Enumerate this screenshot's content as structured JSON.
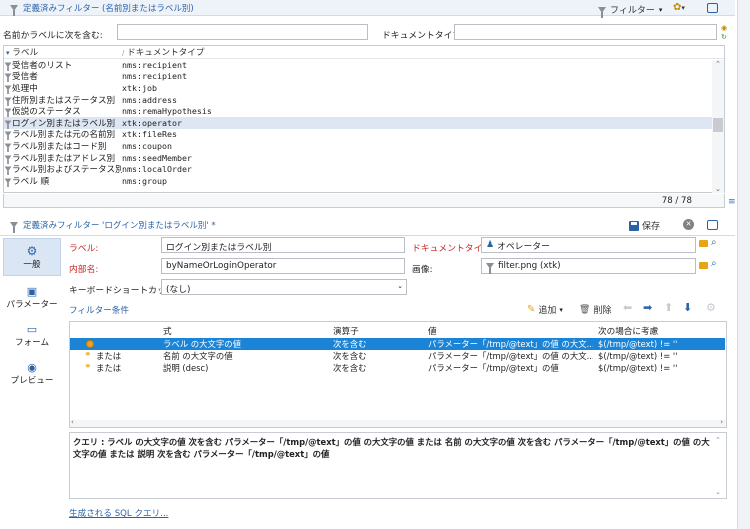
{
  "top": {
    "title": "定義済みフィルター (名前別またはラベル別)",
    "filter_btn": "フィルター",
    "name_label_contains": "名前かラベルに次を含む:",
    "name_value": "",
    "doc_type_label": "ドキュメントタイプ:",
    "doc_type_value": "",
    "col_label": "ラベル",
    "col_doctype": "ドキュメントタイプ",
    "rows": [
      {
        "label": "受信者のリスト",
        "type": "nms:recipient"
      },
      {
        "label": "受信者",
        "type": "nms:recipient"
      },
      {
        "label": "処理中",
        "type": "xtk:job"
      },
      {
        "label": "住所別またはステータス別",
        "type": "nms:address"
      },
      {
        "label": "仮説のステータス",
        "type": "nms:remaHypothesis"
      },
      {
        "label": "ログイン別またはラベル別",
        "type": "xtk:operator"
      },
      {
        "label": "ラベル別または元の名前別",
        "type": "xtk:fileRes"
      },
      {
        "label": "ラベル別またはコード別",
        "type": "nms:coupon"
      },
      {
        "label": "ラベル別またはアドレス別",
        "type": "nms:seedMember"
      },
      {
        "label": "ラベル別およびステータス別",
        "type": "nms:localOrder"
      },
      {
        "label": "ラベル 順",
        "type": "nms:group"
      }
    ],
    "count": "78 / 78"
  },
  "editor": {
    "title": "定義済みフィルター 'ログイン別またはラベル別' *",
    "save": "保存",
    "tabs": [
      {
        "label": "一般"
      },
      {
        "label": "パラメーター"
      },
      {
        "label": "フォーム"
      },
      {
        "label": "プレビュー"
      }
    ],
    "label_lbl": "ラベル:",
    "label_val": "ログイン別またはラベル別",
    "doctype_lbl": "ドキュメントタイプ:",
    "doctype_val": "オペレーター",
    "internal_lbl": "内部名:",
    "internal_val": "byNameOrLoginOperator",
    "image_lbl": "画像:",
    "image_val": "filter.png (xtk)",
    "shortcut_lbl": "キーボードショートカット:",
    "shortcut_val": "(なし)",
    "conditions_link": "フィルター条件",
    "add_btn": "追加",
    "delete_btn": "削除",
    "grid_cols": [
      "式",
      "演算子",
      "値",
      "次の場合に考慮"
    ],
    "grid_rows": [
      {
        "prefix": "",
        "expr": "ラベル の大文字の値",
        "op": "次を含む",
        "val": "パラメーター「/tmp/@text」の値 の大文...",
        "cond": "$(/tmp/@text) != ''"
      },
      {
        "prefix": "または",
        "expr": "名前 の大文字の値",
        "op": "次を含む",
        "val": "パラメーター「/tmp/@text」の値 の大文...",
        "cond": "$(/tmp/@text) != ''"
      },
      {
        "prefix": "または",
        "expr": "説明 (desc)",
        "op": "次を含む",
        "val": "パラメーター「/tmp/@text」の値",
        "cond": "$(/tmp/@text) != ''"
      }
    ],
    "query_text": "クエリ : ラベル の大文字の値 次を含む パラメーター「/tmp/@text」の値 の大文字の値 または 名前 の大文字の値 次を含む パラメーター「/tmp/@text」の値 の大文字の値 または 説明 次を含む パラメーター「/tmp/@text」の値",
    "sql_link": "生成される SQL クエリ..."
  }
}
